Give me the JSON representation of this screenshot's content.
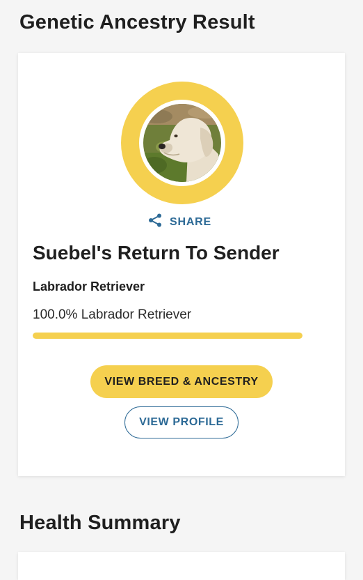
{
  "ancestry_section": {
    "title": "Genetic Ancestry Result"
  },
  "result_card": {
    "photo_icon": "dog-photo",
    "share_icon": "share-icon",
    "share_label": "SHARE",
    "dog_name": "Suebel's Return To Sender",
    "breed_heading": "Labrador Retriever",
    "breakdown": [
      {
        "label": "100.0% Labrador Retriever",
        "breed": "Labrador Retriever",
        "percent": 100.0
      }
    ],
    "primary_button": "VIEW BREED & ANCESTRY",
    "secondary_button": "VIEW PROFILE"
  },
  "health_section": {
    "title": "Health Summary"
  },
  "colors": {
    "page_background": "#f5f5f5",
    "accent_yellow": "#f5d04f",
    "link_blue": "#2d6a96",
    "text_dark": "#1f1f1f"
  }
}
